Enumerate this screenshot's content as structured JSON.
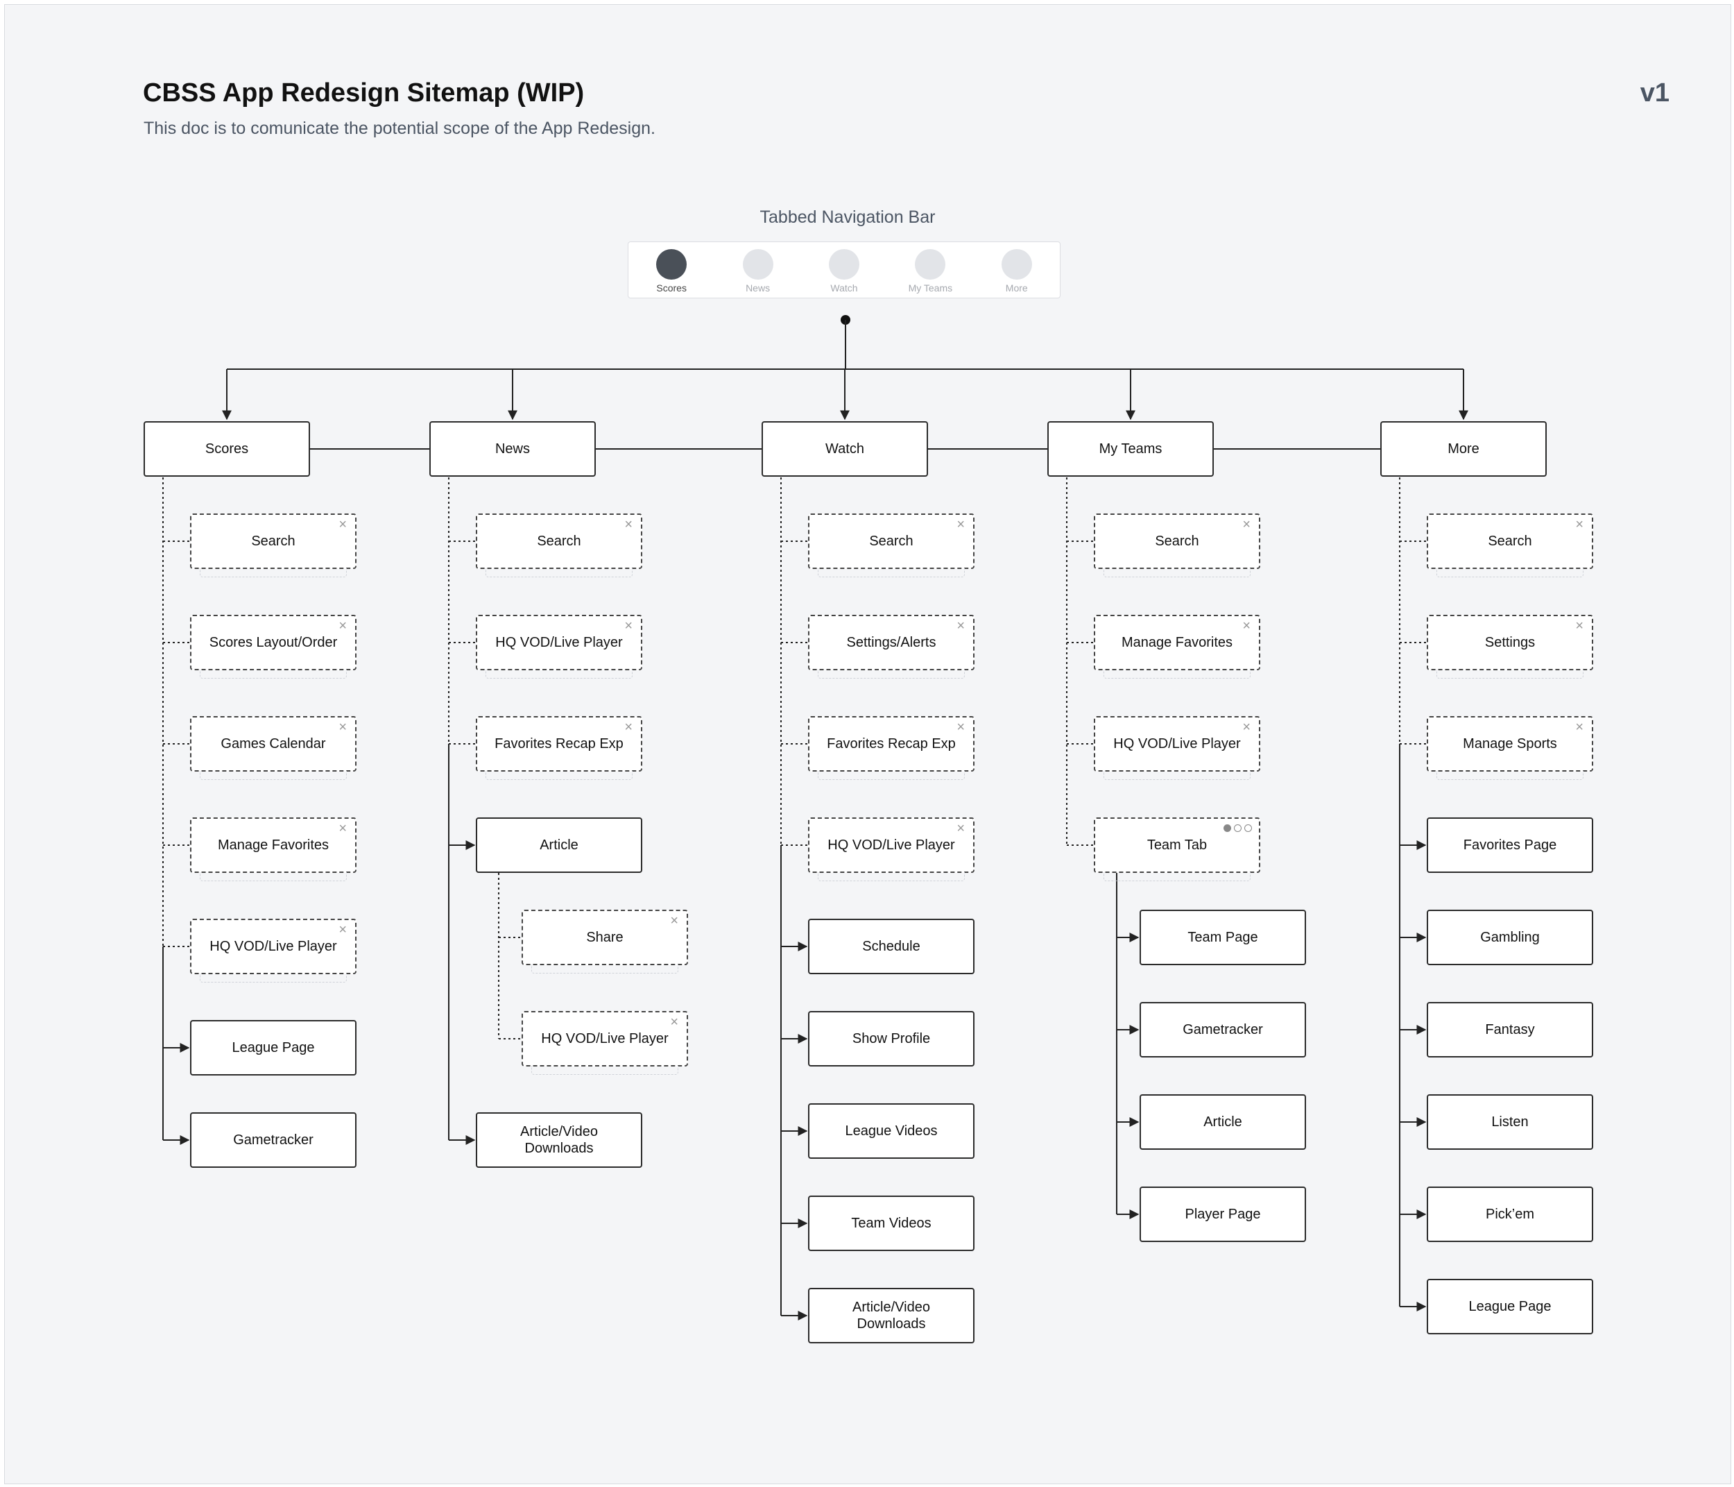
{
  "header": {
    "title": "CBSS App Redesign Sitemap (WIP)",
    "subtitle": "This doc is to comunicate the potential scope of the App Redesign.",
    "version": "v1"
  },
  "nav": {
    "title": "Tabbed Navigation Bar",
    "tabs": [
      {
        "label": "Scores",
        "active": true
      },
      {
        "label": "News",
        "active": false
      },
      {
        "label": "Watch",
        "active": false
      },
      {
        "label": "My Teams",
        "active": false
      },
      {
        "label": "More",
        "active": false
      }
    ]
  },
  "sections": [
    {
      "label": "Scores",
      "children": [
        {
          "label": "Search",
          "kind": "overlay"
        },
        {
          "label": "Scores Layout/Order",
          "kind": "overlay"
        },
        {
          "label": "Games Calendar",
          "kind": "overlay"
        },
        {
          "label": "Manage Favorites",
          "kind": "overlay"
        },
        {
          "label": "HQ VOD/Live Player",
          "kind": "overlay"
        },
        {
          "label": "League Page",
          "kind": "page"
        },
        {
          "label": "Gametracker",
          "kind": "page"
        }
      ]
    },
    {
      "label": "News",
      "children": [
        {
          "label": "Search",
          "kind": "overlay"
        },
        {
          "label": "HQ VOD/Live Player",
          "kind": "overlay"
        },
        {
          "label": "Favorites Recap Exp",
          "kind": "overlay"
        },
        {
          "label": "Article",
          "kind": "page",
          "children": [
            {
              "label": "Share",
              "kind": "overlay"
            },
            {
              "label": "HQ VOD/Live Player",
              "kind": "overlay"
            }
          ]
        },
        {
          "label": "Article/Video Downloads",
          "kind": "page"
        }
      ]
    },
    {
      "label": "Watch",
      "children": [
        {
          "label": "Search",
          "kind": "overlay"
        },
        {
          "label": "Settings/Alerts",
          "kind": "overlay"
        },
        {
          "label": "Favorites Recap Exp",
          "kind": "overlay"
        },
        {
          "label": "HQ VOD/Live Player",
          "kind": "overlay"
        },
        {
          "label": "Schedule",
          "kind": "page"
        },
        {
          "label": "Show Profile",
          "kind": "page"
        },
        {
          "label": "League Videos",
          "kind": "page"
        },
        {
          "label": "Team Videos",
          "kind": "page"
        },
        {
          "label": "Article/Video Downloads",
          "kind": "page"
        }
      ]
    },
    {
      "label": "My Teams",
      "children": [
        {
          "label": "Search",
          "kind": "overlay"
        },
        {
          "label": "Manage Favorites",
          "kind": "overlay"
        },
        {
          "label": "HQ VOD/Live Player",
          "kind": "overlay"
        },
        {
          "label": "Team Tab",
          "kind": "carousel",
          "children": [
            {
              "label": "Team Page",
              "kind": "page"
            },
            {
              "label": "Gametracker",
              "kind": "page"
            },
            {
              "label": "Article",
              "kind": "page"
            },
            {
              "label": "Player Page",
              "kind": "page"
            }
          ]
        }
      ]
    },
    {
      "label": "More",
      "children": [
        {
          "label": "Search",
          "kind": "overlay"
        },
        {
          "label": "Settings",
          "kind": "overlay"
        },
        {
          "label": "Manage Sports",
          "kind": "overlay"
        },
        {
          "label": "Favorites Page",
          "kind": "page"
        },
        {
          "label": "Gambling",
          "kind": "page"
        },
        {
          "label": "Fantasy",
          "kind": "page"
        },
        {
          "label": "Listen",
          "kind": "page"
        },
        {
          "label": "Pick’em",
          "kind": "page"
        },
        {
          "label": "League Page",
          "kind": "page"
        }
      ]
    }
  ],
  "icons": {
    "close": "close-icon",
    "carousel": "carousel-dots-icon"
  }
}
